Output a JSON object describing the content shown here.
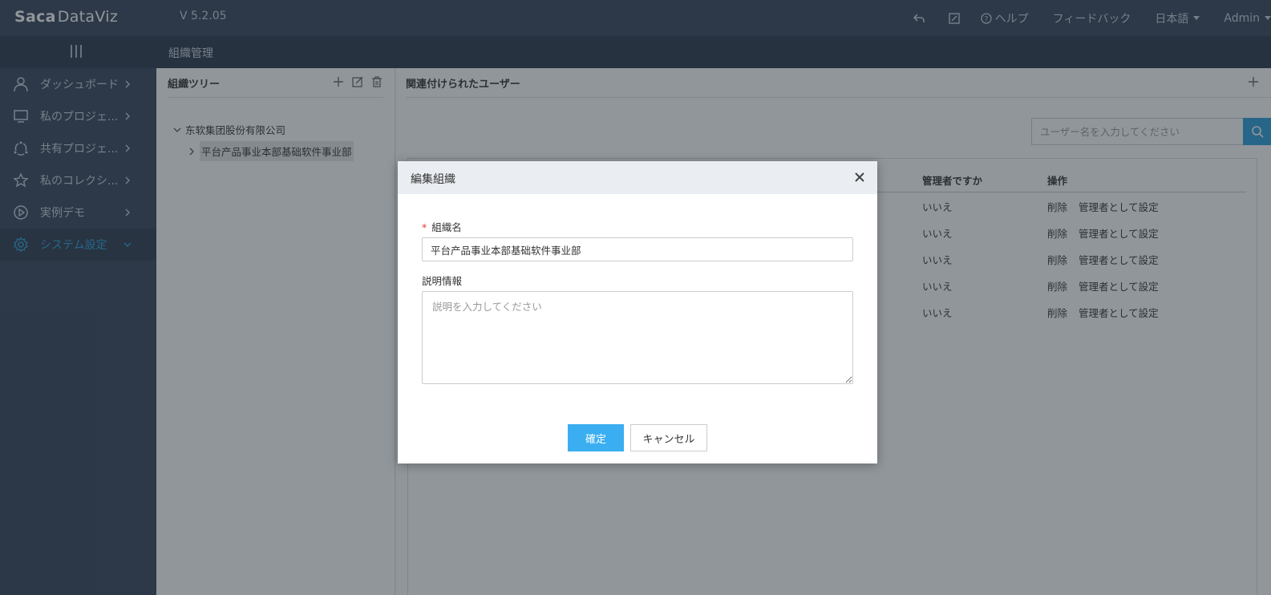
{
  "header": {
    "logo_brand": "Saca",
    "logo_product": "DataViz",
    "version": "V 5.2.05",
    "help_label": "ヘルプ",
    "feedback_label": "フィードバック",
    "language_label": "日本語",
    "user_label": "Admin"
  },
  "breadcrumb": {
    "title": "組織管理"
  },
  "sidebar": {
    "items": [
      {
        "label": "ダッシュボード",
        "icon": "user-icon"
      },
      {
        "label": "私のプロジェ...",
        "icon": "monitor-icon"
      },
      {
        "label": "共有プロジェ...",
        "icon": "share-icon"
      },
      {
        "label": "私のコレクシ...",
        "icon": "star-icon"
      },
      {
        "label": "実例デモ",
        "icon": "play-icon"
      },
      {
        "label": "システム設定",
        "icon": "gear-icon"
      }
    ],
    "active_color": "#2b9fd9"
  },
  "tree_panel": {
    "title": "組織ツリー",
    "root": "东软集团股份有限公司",
    "child": "平台产品事业本部基础软件事业部"
  },
  "user_panel": {
    "title": "関連付けられたユーザー",
    "search_placeholder": "ユーザー名を入力してください",
    "columns": {
      "is_admin": "管理者ですか",
      "actions": "操作"
    },
    "rows": [
      {
        "is_admin": "いいえ",
        "delete": "削除",
        "set_admin": "管理者として設定"
      },
      {
        "is_admin": "いいえ",
        "delete": "削除",
        "set_admin": "管理者として設定"
      },
      {
        "is_admin": "いいえ",
        "delete": "削除",
        "set_admin": "管理者として設定"
      },
      {
        "is_admin": "いいえ",
        "delete": "削除",
        "set_admin": "管理者として設定"
      },
      {
        "is_admin": "いいえ",
        "delete": "削除",
        "set_admin": "管理者として設定"
      }
    ]
  },
  "modal": {
    "title": "編集組織",
    "required_mark": "*",
    "name_label": "組織名",
    "name_value": "平台产品事业本部基础软件事业部",
    "desc_label": "説明情報",
    "desc_placeholder": "説明を入力してください",
    "ok_label": "確定",
    "cancel_label": "キャンセル"
  },
  "colors": {
    "topbar": "#364458",
    "accent": "#2b9fd9",
    "ok_button": "#3aaef0"
  }
}
